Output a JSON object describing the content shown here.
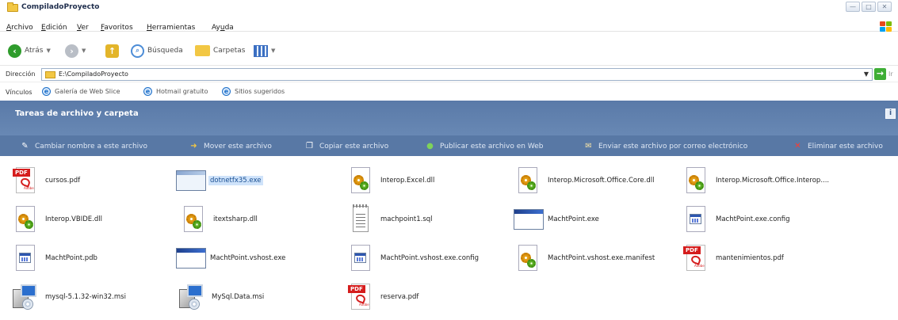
{
  "window": {
    "title": "CompiladoProyecto",
    "controls": [
      "—",
      "□",
      "✕"
    ]
  },
  "menu": {
    "items": [
      {
        "label": "Archivo",
        "u": "A",
        "rest": "rchivo"
      },
      {
        "label": "Edición",
        "u": "E",
        "rest": "dición"
      },
      {
        "label": "Ver",
        "u": "V",
        "rest": "er"
      },
      {
        "label": "Favoritos",
        "u": "F",
        "rest": "avoritos"
      },
      {
        "label": "Herramientas",
        "u": "H",
        "rest": "erramientas"
      },
      {
        "label": "Ayuda",
        "pre": "Ay",
        "u": "u",
        "rest": "da"
      }
    ]
  },
  "toolbar": {
    "back_label": "Atrás",
    "search_label": "Búsqueda",
    "folders_label": "Carpetas"
  },
  "address": {
    "label": "Dirección",
    "value": "E:\\CompiladoProyecto",
    "go_label": "Ir"
  },
  "links": {
    "label": "Vínculos",
    "items": [
      "Galería de Web Slice",
      "Hotmail gratuito",
      "Sitios sugeridos"
    ]
  },
  "taskpane": {
    "title": "Tareas de archivo y carpeta",
    "tasks": [
      {
        "label": "Cambiar nombre a este archivo",
        "icon": "rename-icon"
      },
      {
        "label": "Mover este archivo",
        "icon": "move-icon"
      },
      {
        "label": "Copiar este archivo",
        "icon": "copy-icon"
      },
      {
        "label": "Publicar este archivo en Web",
        "icon": "globe-icon"
      },
      {
        "label": "Enviar este archivo por correo electrónico",
        "icon": "email-icon"
      },
      {
        "label": "Eliminar este archivo",
        "icon": "delete-icon"
      }
    ]
  },
  "files": [
    {
      "name": "cursos.pdf",
      "type": "pdf"
    },
    {
      "name": "dotnetfx35.exe",
      "type": "exe-pale",
      "selected": true
    },
    {
      "name": "Interop.Excel.dll",
      "type": "dll"
    },
    {
      "name": "Interop.Microsoft.Office.Core.dll",
      "type": "dll"
    },
    {
      "name": "Interop.Microsoft.Office.Interop....",
      "type": "dll"
    },
    {
      "name": "Interop.VBIDE.dll",
      "type": "dll"
    },
    {
      "name": "itextsharp.dll",
      "type": "dll"
    },
    {
      "name": "machpoint1.sql",
      "type": "sql"
    },
    {
      "name": "MachtPoint.exe",
      "type": "exe"
    },
    {
      "name": "MachtPoint.exe.config",
      "type": "config"
    },
    {
      "name": "MachtPoint.pdb",
      "type": "config"
    },
    {
      "name": "MachtPoint.vshost.exe",
      "type": "exe"
    },
    {
      "name": "MachtPoint.vshost.exe.config",
      "type": "config"
    },
    {
      "name": "MachtPoint.vshost.exe.manifest",
      "type": "dll"
    },
    {
      "name": "mantenimientos.pdf",
      "type": "pdf"
    },
    {
      "name": "mysql-5.1.32-win32.msi",
      "type": "msi"
    },
    {
      "name": "MySql.Data.msi",
      "type": "msi"
    },
    {
      "name": "reserva.pdf",
      "type": "pdf"
    }
  ]
}
